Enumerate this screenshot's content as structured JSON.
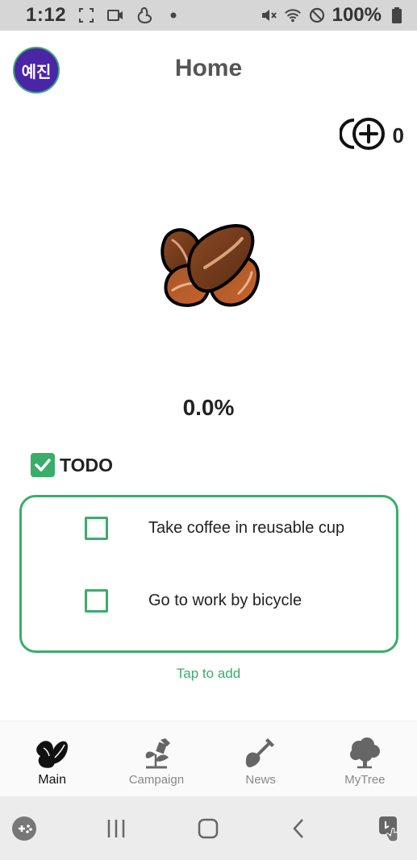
{
  "status_bar": {
    "time": "1:12",
    "battery": "100%",
    "icons": [
      "screenshot-frame-icon",
      "screen-record-icon",
      "assistant-icon",
      "dot-icon",
      "mute-icon",
      "wifi-icon",
      "do-not-disturb-icon",
      "battery-icon"
    ]
  },
  "header": {
    "avatar_text": "예진",
    "title": "Home"
  },
  "points": {
    "count": "0",
    "icon": "coin-plus-icon"
  },
  "plant": {
    "icon": "seed-icon",
    "progress": "0.0%"
  },
  "todo": {
    "title": "TODO",
    "items": [
      {
        "label": "Take coffee in reusable cup",
        "checked": false
      },
      {
        "label": "Go to work by bicycle",
        "checked": false
      }
    ],
    "add_hint": "Tap to add"
  },
  "bottom_nav": {
    "items": [
      {
        "label": "Main",
        "icon": "seed-icon",
        "active": true
      },
      {
        "label": "Campaign",
        "icon": "watering-can-icon",
        "active": false
      },
      {
        "label": "News",
        "icon": "shovel-icon",
        "active": false
      },
      {
        "label": "MyTree",
        "icon": "tree-icon",
        "active": false
      }
    ]
  },
  "colors": {
    "accent": "#3aad6a",
    "avatar_bg": "#4a25a8",
    "status_bar_bg": "#d6d6d6"
  }
}
